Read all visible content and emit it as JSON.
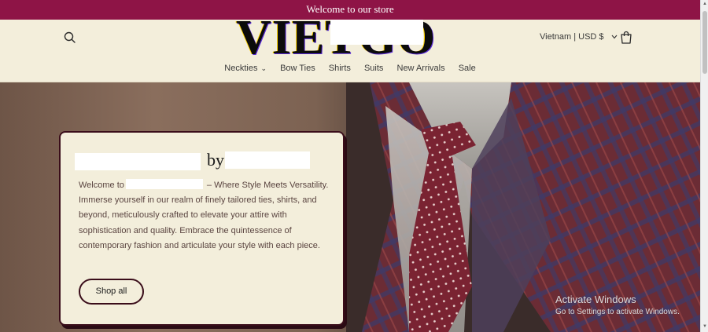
{
  "announcement": "Welcome to our store",
  "header": {
    "logo_text": "VIETGO",
    "locale": "Vietnam | USD $",
    "icons": {
      "search": "search-icon",
      "cart": "cart-icon",
      "chevron": "chevron-down-icon"
    }
  },
  "nav": {
    "items": [
      {
        "label": "Neckties",
        "has_dropdown": true
      },
      {
        "label": "Bow Ties"
      },
      {
        "label": "Shirts"
      },
      {
        "label": "Suits"
      },
      {
        "label": "New Arrivals"
      },
      {
        "label": "Sale"
      }
    ]
  },
  "hero": {
    "title_connector": "by",
    "body_prefix": "Welcome to",
    "body_line1_suffix": " – Where Style Meets",
    "body_rest": "Versatility. Immerse yourself in our realm of finely tailored ties, shirts, and beyond, meticulously crafted to elevate your attire with sophistication and quality. Embrace the quintessence of contemporary fashion and articulate your style with each piece.",
    "button_label": "Shop all"
  },
  "watermark": {
    "title": "Activate Windows",
    "subtitle": "Go to Settings to activate Windows."
  },
  "colors": {
    "announcement_bg": "#8e1446",
    "page_bg": "#f3eedb",
    "accent_dark": "#3a0d1a",
    "tie": "#7a2332"
  }
}
